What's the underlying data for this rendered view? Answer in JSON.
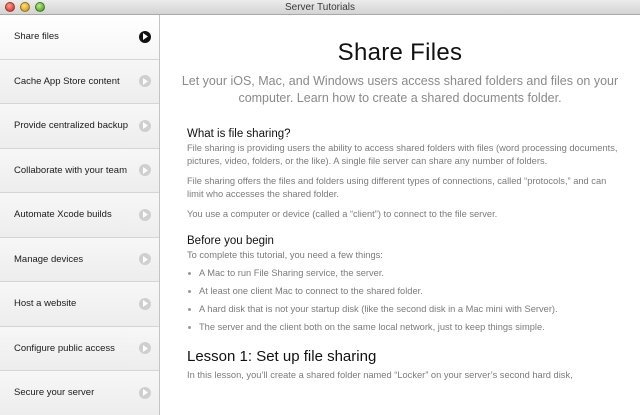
{
  "window": {
    "title": "Server Tutorials"
  },
  "sidebar": {
    "items": [
      {
        "label": "Share files",
        "selected": true
      },
      {
        "label": "Cache App Store content"
      },
      {
        "label": "Provide centralized backup"
      },
      {
        "label": "Collaborate with your team"
      },
      {
        "label": "Automate Xcode builds"
      },
      {
        "label": "Manage devices"
      },
      {
        "label": "Host a website"
      },
      {
        "label": "Configure public access"
      },
      {
        "label": "Secure your server"
      }
    ]
  },
  "main": {
    "title": "Share Files",
    "subtitle": "Let your iOS, Mac, and Windows users access shared folders and files on your computer. Learn how to create a shared documents folder.",
    "sections": {
      "what": {
        "heading": "What is file sharing?",
        "paragraphs": [
          "File sharing is providing users the ability to access shared folders with files (word processing documents, pictures, video, folders, or the like). A single file server can share any number of folders.",
          "File sharing offers the files and folders using different types of connections, called “protocols,” and can limit who accesses the shared folder.",
          "You use a computer or device (called a “client”) to connect to the file server."
        ]
      },
      "before": {
        "heading": "Before you begin",
        "intro": "To complete this tutorial, you need a few things:",
        "items": [
          "A Mac to run File Sharing service, the server.",
          "At least one client Mac to connect to the shared folder.",
          "A hard disk that is not your startup disk (like the second disk in a Mac mini with Server).",
          "The server and the client both on the same local network, just to keep things simple."
        ]
      },
      "lesson1": {
        "heading": "Lesson 1: Set up file sharing",
        "text": "In this lesson, you’ll create a shared folder named “Locker” on your server’s second hard disk,"
      }
    }
  },
  "colors": {
    "selected_arrow": "#111111",
    "arrow": "#cfcfcf",
    "body_text": "#7b7b7b",
    "subtitle_text": "#8a8a8a"
  },
  "icons": {
    "window_controls": [
      "close-icon",
      "minimize-icon",
      "zoom-icon"
    ],
    "sidebar_arrow": "chevron-right-circle-icon"
  }
}
